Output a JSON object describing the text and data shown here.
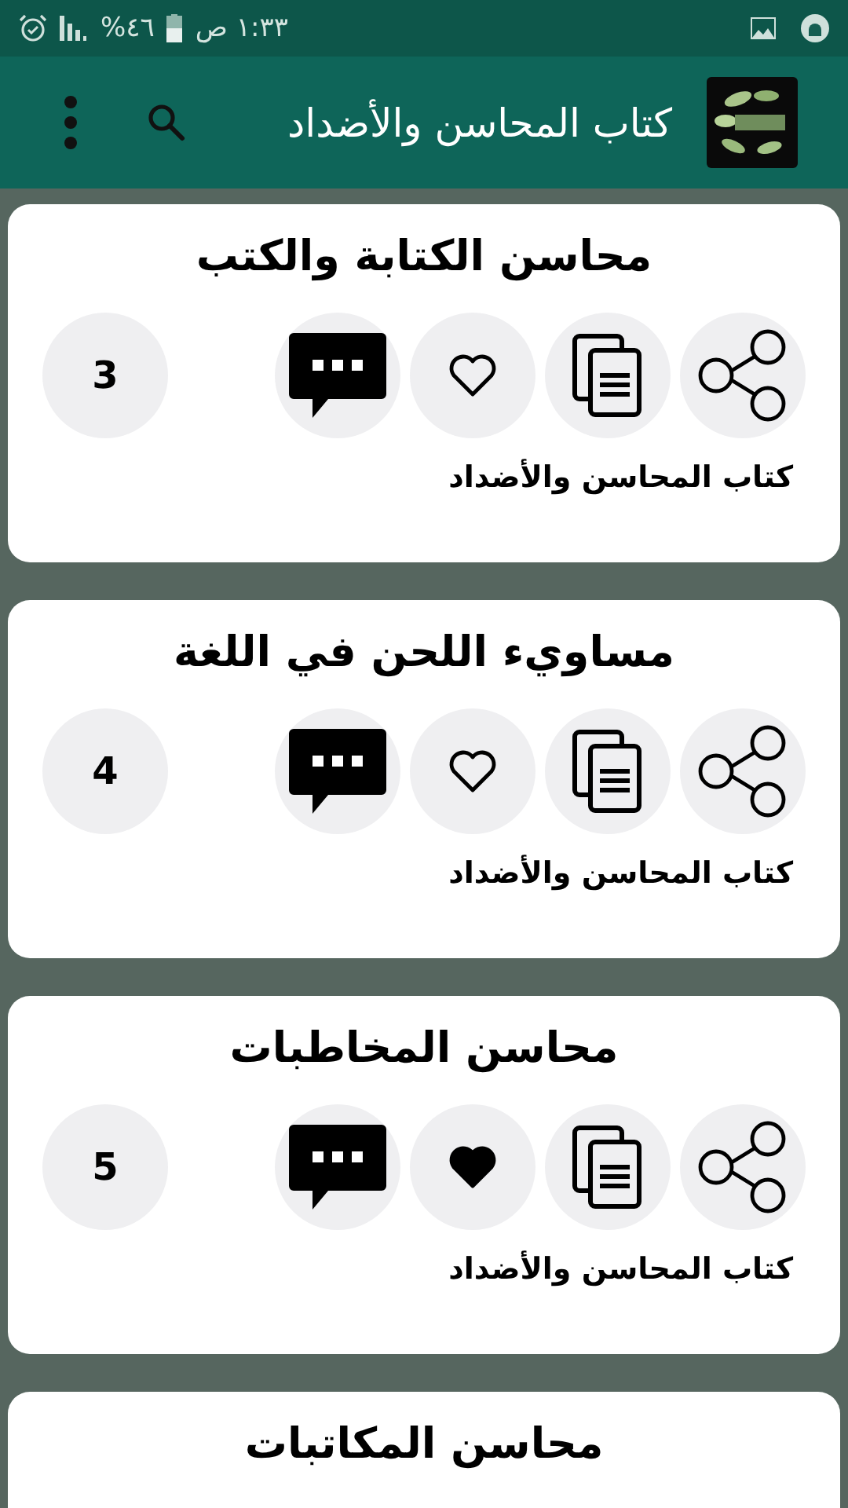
{
  "status_bar": {
    "time": "١:٣٣ ص",
    "battery": "%٤٦"
  },
  "app_bar": {
    "title": "كتاب المحاسن والأضداد"
  },
  "cards": [
    {
      "title": "محاسن الكتابة والكتب",
      "liked": false,
      "count": "3",
      "subtitle": "كتاب المحاسن والأضداد"
    },
    {
      "title": "مساويء اللحن في اللغة",
      "liked": false,
      "count": "4",
      "subtitle": "كتاب المحاسن والأضداد"
    },
    {
      "title": "محاسن المخاطبات",
      "liked": true,
      "count": "5",
      "subtitle": "كتاب المحاسن والأضداد"
    },
    {
      "title": "محاسن المكاتبات"
    }
  ]
}
